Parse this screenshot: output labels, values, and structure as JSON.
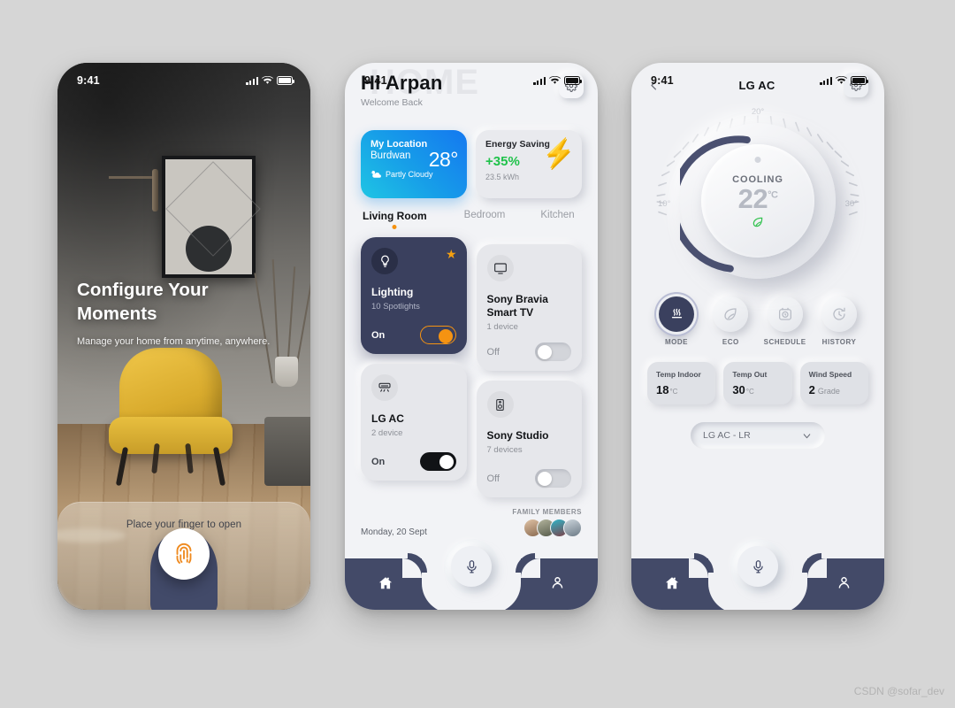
{
  "meta": {
    "background_color": "#d6d6d6",
    "credit": "CSDN @sofar_dev"
  },
  "status_bar": {
    "time": "9:41"
  },
  "screen_onboarding": {
    "title_line1": "Configure Your",
    "title_line2": "Moments",
    "subtitle": "Manage your home from anytime, anywhere.",
    "unlock_hint": "Place your finger to open",
    "fingerprint_icon": "fingerprint-icon",
    "accent_color": "#ef8a1f"
  },
  "screen_home": {
    "watermark": "HOME",
    "greeting": "Hi  Arpan",
    "welcome": "Welcome Back",
    "settings_icon": "gear-icon",
    "weather_card": {
      "title": "My Location",
      "city": "Burdwan",
      "temperature": "28°",
      "condition": "Partly Cloudy",
      "condition_icon": "partly-cloudy-icon",
      "gradient_from": "#1478f0",
      "gradient_to": "#1fc5e4"
    },
    "energy_card": {
      "title": "Energy Saving",
      "percent": "+35%",
      "usage": "23.5 kWh",
      "icon": "lightning-bolt-icon",
      "percent_color": "#1fc24a"
    },
    "room_tabs": [
      {
        "label": "Living Room",
        "active": true
      },
      {
        "label": "Bedroom",
        "active": false
      },
      {
        "label": "Kitchen",
        "active": false
      }
    ],
    "devices": [
      {
        "name": "Lighting",
        "meta": "10 Spotlights",
        "state": "On",
        "icon": "lightbulb-icon",
        "dark": true,
        "favorite": true
      },
      {
        "name": "Sony Bravia Smart TV",
        "meta": "1 device",
        "state": "Off",
        "icon": "tv-icon",
        "dark": false,
        "favorite": false
      },
      {
        "name": "LG AC",
        "meta": "2 device",
        "state": "On",
        "icon": "air-conditioner-icon",
        "dark": false,
        "favorite": false
      },
      {
        "name": "Sony Studio",
        "meta": "7 devices",
        "state": "Off",
        "icon": "speaker-icon",
        "dark": false,
        "favorite": false
      }
    ],
    "date": "Monday, 20 Sept",
    "family_label": "FAMILY MEMBERS",
    "family_avatars": [
      "#c9a98e",
      "#8b8d7a",
      "#9b5f63",
      "#a8b3bd"
    ]
  },
  "screen_ac": {
    "back_icon": "chevron-left-icon",
    "title": "LG AC",
    "settings_icon": "gear-icon",
    "dial": {
      "mode_text": "COOLING",
      "temperature": "22",
      "unit": "°C",
      "eco_icon": "leaf-icon",
      "tick_min": "10°",
      "tick_mid": "20°",
      "tick_max": "30°",
      "arc_color": "#4a5070"
    },
    "modes": [
      {
        "label": "MODE",
        "icon": "heat-waves-icon",
        "active": true
      },
      {
        "label": "ECO",
        "icon": "leaf-icon",
        "active": false
      },
      {
        "label": "SCHEDULE",
        "icon": "timer-icon",
        "active": false
      },
      {
        "label": "HISTORY",
        "icon": "history-clock-icon",
        "active": false
      }
    ],
    "stats": [
      {
        "label": "Temp Indoor",
        "value": "18",
        "unit": "°C",
        "suffix": ""
      },
      {
        "label": "Temp Out",
        "value": "30",
        "unit": "°C",
        "suffix": ""
      },
      {
        "label": "Wind Speed",
        "value": "2",
        "unit": "",
        "suffix": "Grade"
      }
    ],
    "device_selector": {
      "value": "LG AC - LR",
      "chevron_icon": "chevron-down-icon"
    }
  },
  "bottom_nav": {
    "home_icon": "home-icon",
    "mic_icon": "microphone-icon",
    "profile_icon": "person-icon",
    "bar_color": "#434a68"
  }
}
